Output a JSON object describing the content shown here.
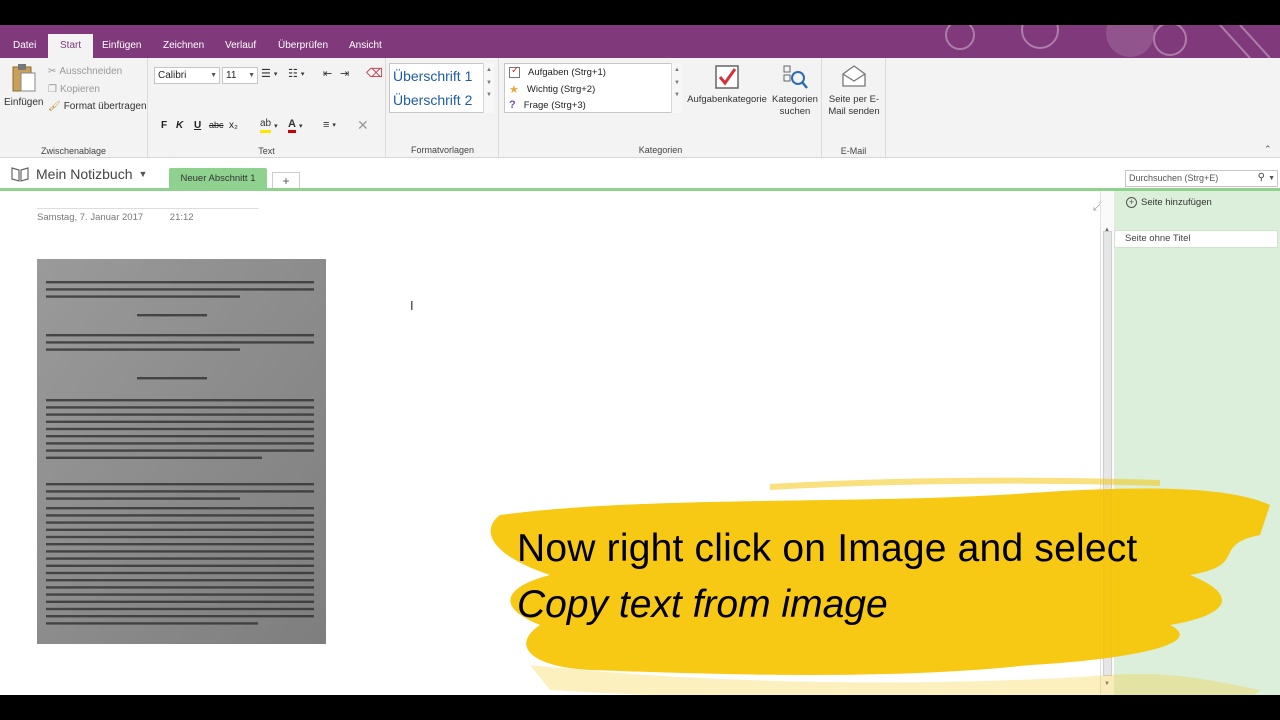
{
  "ribbon_tabs": [
    "Datei",
    "Start",
    "Einfügen",
    "Zeichnen",
    "Verlauf",
    "Überprüfen",
    "Ansicht"
  ],
  "clipboard": {
    "paste": "Einfügen",
    "cut": "Ausschneiden",
    "copy": "Kopieren",
    "format_painter": "Format übertragen",
    "label": "Zwischenablage"
  },
  "text_group": {
    "font": "Calibri",
    "size": "11",
    "bold": "F",
    "italic": "K",
    "underline": "U",
    "strike": "abc",
    "subscript": "x₂",
    "label": "Text"
  },
  "styles": {
    "h1": "Überschrift 1",
    "h2": "Überschrift 2",
    "label": "Formatvorlagen"
  },
  "tags": {
    "items": [
      "Aufgaben (Strg+1)",
      "Wichtig (Strg+2)",
      "Frage (Strg+3)"
    ],
    "todo_tag": "Aufgabenkategorie",
    "find_tags_1": "Kategorien",
    "find_tags_2": "suchen",
    "label": "Kategorien"
  },
  "email": {
    "line1": "Seite per E-",
    "line2": "Mail senden",
    "label": "E-Mail"
  },
  "notebook": {
    "name": "Mein Notizbuch",
    "section": "Neuer Abschnitt 1",
    "add_section": "+",
    "search_placeholder": "Durchsuchen (Strg+E)"
  },
  "page": {
    "date": "Samstag, 7. Januar 2017",
    "time": "21:12"
  },
  "pagelist": {
    "add_page": "Seite hinzufügen",
    "page_title": "Seite ohne Titel"
  },
  "caption": {
    "line1": "Now right click on Image and select",
    "line2": "Copy text from image"
  },
  "colors": {
    "accent": "#80397b",
    "section_green": "#8fd18e",
    "brush_yellow": "#f6c400"
  }
}
